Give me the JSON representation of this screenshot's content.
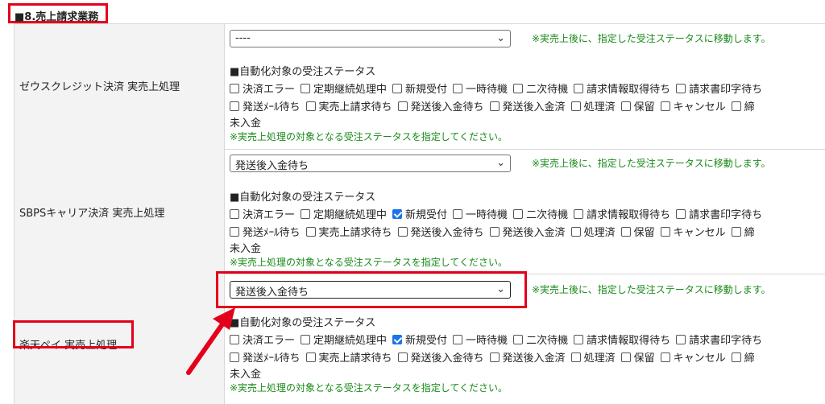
{
  "section_title": "■8.売上請求業務",
  "move_note": "※実売上後に、指定した受注ステータスに移動します。",
  "subhead": "■自動化対象の受注ステータス",
  "wrap_text": "未入金",
  "hint": "※実売上処理の対象となる受注ステータスを指定してください。",
  "rows": [
    {
      "label": "ゼウスクレジット決済 実売上処理",
      "select_value": "----",
      "line1": [
        {
          "label": "決済エラー",
          "checked": false
        },
        {
          "label": "定期継続処理中",
          "checked": false
        },
        {
          "label": "新規受付",
          "checked": false
        },
        {
          "label": "一時待機",
          "checked": false
        },
        {
          "label": "二次待機",
          "checked": false
        },
        {
          "label": "請求情報取得待ち",
          "checked": false
        },
        {
          "label": "請求書印字待ち",
          "checked": false
        }
      ],
      "line2": [
        {
          "label": "発送ﾒｰﾙ待ち",
          "checked": false
        },
        {
          "label": "実売上請求待ち",
          "checked": false
        },
        {
          "label": "発送後入金待ち",
          "checked": false
        },
        {
          "label": "発送後入金済",
          "checked": false
        },
        {
          "label": "処理済",
          "checked": false
        },
        {
          "label": "保留",
          "checked": false
        },
        {
          "label": "キャンセル",
          "checked": false
        },
        {
          "label": "締",
          "checked": false
        }
      ]
    },
    {
      "label": "SBPSキャリア決済 実売上処理",
      "select_value": "発送後入金待ち",
      "line1": [
        {
          "label": "決済エラー",
          "checked": false
        },
        {
          "label": "定期継続処理中",
          "checked": false
        },
        {
          "label": "新規受付",
          "checked": true
        },
        {
          "label": "一時待機",
          "checked": false
        },
        {
          "label": "二次待機",
          "checked": false
        },
        {
          "label": "請求情報取得待ち",
          "checked": false
        },
        {
          "label": "請求書印字待ち",
          "checked": false
        }
      ],
      "line2": [
        {
          "label": "発送ﾒｰﾙ待ち",
          "checked": false
        },
        {
          "label": "実売上請求待ち",
          "checked": false
        },
        {
          "label": "発送後入金待ち",
          "checked": false
        },
        {
          "label": "発送後入金済",
          "checked": false
        },
        {
          "label": "処理済",
          "checked": false
        },
        {
          "label": "保留",
          "checked": false
        },
        {
          "label": "キャンセル",
          "checked": false
        },
        {
          "label": "締",
          "checked": false
        }
      ]
    },
    {
      "label": "楽天ペイ 実売上処理",
      "select_value": "発送後入金待ち",
      "line1": [
        {
          "label": "決済エラー",
          "checked": false
        },
        {
          "label": "定期継続処理中",
          "checked": false
        },
        {
          "label": "新規受付",
          "checked": true
        },
        {
          "label": "一時待機",
          "checked": false
        },
        {
          "label": "二次待機",
          "checked": false
        },
        {
          "label": "請求情報取得待ち",
          "checked": false
        },
        {
          "label": "請求書印字待ち",
          "checked": false
        }
      ],
      "line2": [
        {
          "label": "発送ﾒｰﾙ待ち",
          "checked": false
        },
        {
          "label": "実売上請求待ち",
          "checked": false
        },
        {
          "label": "発送後入金待ち",
          "checked": false
        },
        {
          "label": "発送後入金済",
          "checked": false
        },
        {
          "label": "処理済",
          "checked": false
        },
        {
          "label": "保留",
          "checked": false
        },
        {
          "label": "キャンセル",
          "checked": false
        },
        {
          "label": "締",
          "checked": false
        }
      ]
    }
  ],
  "colors": {
    "highlight": "#e4001b",
    "note": "#1a8a1a",
    "check": "#1a73e8"
  },
  "icons": {
    "select_arrow": "chevron-down-icon",
    "pointer": "arrow-icon"
  }
}
